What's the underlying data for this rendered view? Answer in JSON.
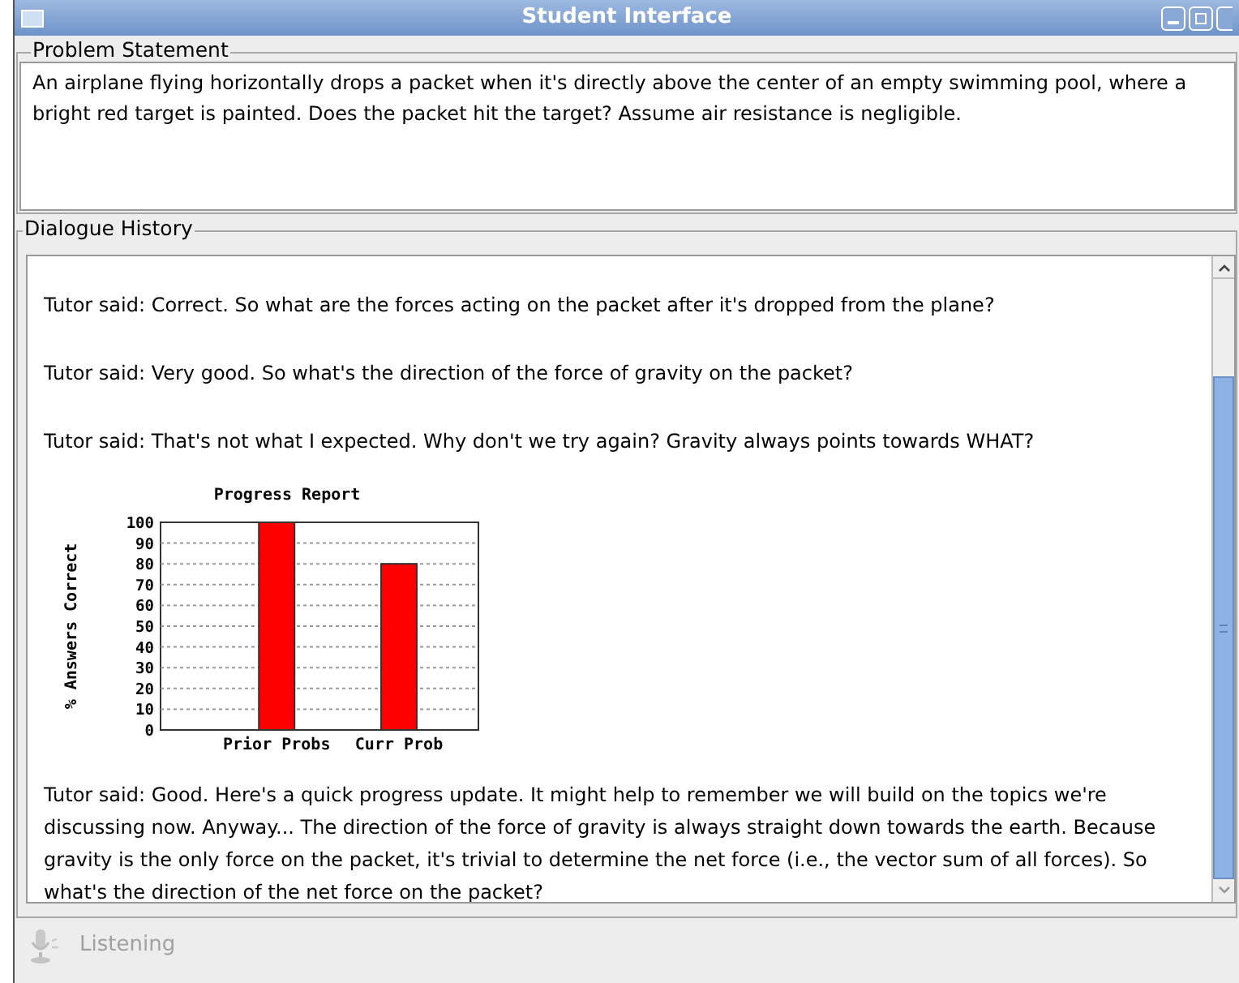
{
  "window": {
    "title": "Student Interface"
  },
  "problem_statement": {
    "label": "Problem Statement",
    "text": "An airplane flying horizontally drops a packet when it's directly above the center of an empty swimming pool, where a bright red target is painted. Does the packet hit the target? Assume air resistance is negligible."
  },
  "dialogue_history": {
    "label": "Dialogue History",
    "items": [
      {
        "kind": "text",
        "text": "Tutor said: Correct. So what are the forces acting on the packet after it's dropped from the plane?"
      },
      {
        "kind": "text",
        "text": "Tutor said: Very good. So what's the direction of the force of gravity on the packet?"
      },
      {
        "kind": "text",
        "text": "Tutor said: That's not what I expected. Why don't we try again? Gravity always points towards WHAT?"
      },
      {
        "kind": "chart",
        "chart_data": {
          "type": "bar",
          "title": "Progress Report",
          "ylabel": "% Answers Correct",
          "categories": [
            "Prior Probs",
            "Curr Prob"
          ],
          "series": [
            {
              "color": "#ff0000",
              "values": [
                100,
                80
              ]
            }
          ],
          "grid": true,
          "ylim": [
            0,
            100
          ],
          "yticks": [
            0,
            10,
            20,
            30,
            40,
            50,
            60,
            70,
            80,
            90,
            100
          ]
        }
      },
      {
        "kind": "text",
        "text": "Tutor said: Good. Here's a quick progress update. It might help to remember we will build on the topics we're discussing now. Anyway... The direction of the force of gravity is always straight down towards the earth. Because gravity is the only force on the packet, it's trivial to determine the net force (i.e., the vector sum of all forces). So what's the direction of the net force on the packet?"
      }
    ]
  },
  "status": {
    "text": "Listening",
    "disabled": true
  }
}
